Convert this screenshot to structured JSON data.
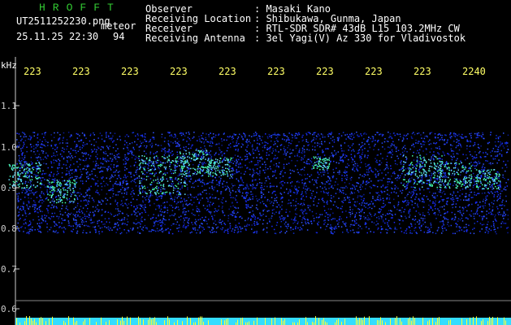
{
  "header": {
    "brand": "HROFFT",
    "file_name": "UT2511252230.png",
    "meteor_label": "meteor",
    "datetime": "25.11.25 22:30",
    "count": "94",
    "info_labels": [
      "Observer",
      "Receiving Location",
      "Receiver",
      "Receiving Antenna"
    ],
    "info_values": [
      ": Masaki Kano",
      ": Shibukawa, Gunma, Japan",
      ": RTL-SDR SDR# 43dB L15 103.2MHz CW",
      ": 3el Yagi(V) Az 330 for Vladivostok"
    ]
  },
  "axis": {
    "unit": "kHz",
    "y_ticks": [
      "1.1",
      "1.0",
      "0.9",
      "0.8",
      "0.7",
      "0.6"
    ],
    "time_ticks": [
      "223",
      "223",
      "223",
      "223",
      "223",
      "223",
      "223",
      "223",
      "223",
      "2240"
    ]
  },
  "colors": {
    "brand": "#33cc33",
    "header_text": "#ffffff",
    "time_text": "#ffff66",
    "axis": "#cccccc",
    "signal": "#2244ff",
    "signal_hot": "#44ffaa",
    "baseline": "#33ddff"
  }
}
